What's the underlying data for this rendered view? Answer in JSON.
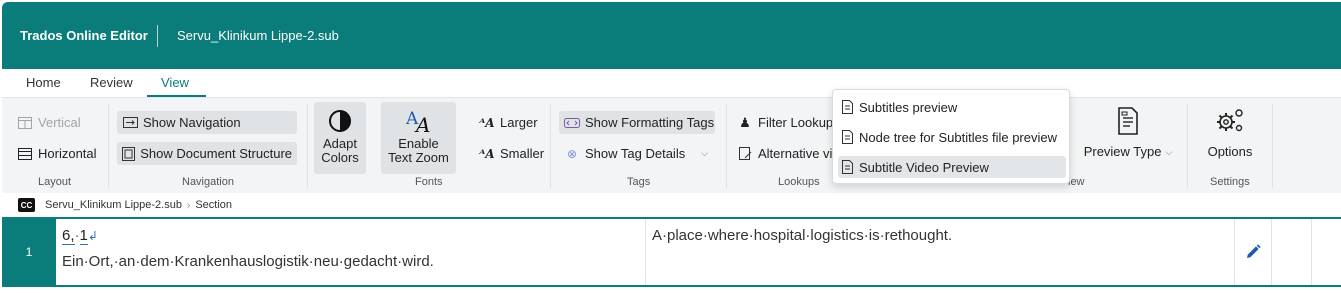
{
  "header": {
    "app_name": "Trados Online Editor",
    "document_name": "Servu_Klinikum Lippe-2.sub"
  },
  "tabs": [
    {
      "label": "Home",
      "active": false
    },
    {
      "label": "Review",
      "active": false
    },
    {
      "label": "View",
      "active": true
    }
  ],
  "ribbon": {
    "layout": {
      "vertical": "Vertical",
      "horizontal": "Horizontal",
      "group_label": "Layout"
    },
    "navigation": {
      "show_navigation": "Show Navigation",
      "show_document_structure": "Show Document Structure",
      "group_label": "Navigation"
    },
    "fonts": {
      "adapt_colors_line1": "Adapt",
      "adapt_colors_line2": "Colors",
      "enable_zoom_line1": "Enable",
      "enable_zoom_line2": "Text Zoom",
      "larger": "Larger",
      "smaller": "Smaller",
      "group_label": "Fonts"
    },
    "tags": {
      "show_formatting_tags": "Show Formatting Tags",
      "show_tag_details": "Show Tag Details",
      "group_label": "Tags"
    },
    "lookups": {
      "filter_lookups": "Filter Lookups",
      "alternative": "Alternative vi",
      "group_label": "Lookups"
    },
    "preview": {
      "preview_type": "Preview Type",
      "group_label_partial": "iew"
    },
    "settings": {
      "options": "Options",
      "group_label": "Settings"
    }
  },
  "preview_menu": {
    "items": [
      {
        "label": "Subtitles preview",
        "selected": false
      },
      {
        "label": "Node tree for Subtitles file preview",
        "selected": false
      },
      {
        "label": "Subtitle Video Preview",
        "selected": true
      }
    ]
  },
  "breadcrumb": {
    "badge": "CC",
    "file": "Servu_Klinikum Lippe-2.sub",
    "section": "Section"
  },
  "segment": {
    "number": "1",
    "source_timecode_a": "6,",
    "source_timecode_b": "1",
    "source_text": "Ein·Ort,·an·dem·Krankenhauslogistik·neu·gedacht·wird.",
    "target_text": "A·place·where·hospital·logistics·is·rethought."
  },
  "colors": {
    "brand": "#0a7c7a",
    "selected_bg": "#dfe3e6",
    "edit_icon": "#1e5aa8"
  }
}
